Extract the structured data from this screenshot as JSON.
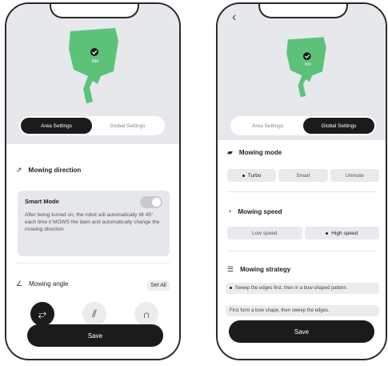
{
  "left_screen": {
    "tabs": [
      {
        "label": "Area Settings",
        "active": true
      },
      {
        "label": "Global Settings",
        "active": false
      }
    ],
    "mowing_direction_title": "Mowing direction",
    "smart_mode": {
      "title": "Smart Mode",
      "enabled": false,
      "description": "After being turned on, the robot will automatically tilt 45° each time it MOWS the lawn and automatically change the mowing direction"
    },
    "mowing_angle_title": "Mowing angle",
    "set_all_label": "Set All",
    "pattern_icons": [
      "bow-pattern-icon",
      "diagonal-pattern-icon",
      "vertical-pattern-icon"
    ],
    "save_label": "Save",
    "map_label": "899"
  },
  "right_screen": {
    "tabs": [
      {
        "label": "Area Settings",
        "active": false
      },
      {
        "label": "Global Settings",
        "active": true
      }
    ],
    "mowing_mode": {
      "title": "Mowing mode",
      "options": [
        {
          "label": "Turbo",
          "selected": true
        },
        {
          "label": "Smart",
          "selected": false
        },
        {
          "label": "Unmute",
          "selected": false
        }
      ]
    },
    "mowing_speed": {
      "title": "Mowing speed",
      "options": [
        {
          "label": "Low speed",
          "selected": false
        },
        {
          "label": "High speed",
          "selected": true
        }
      ]
    },
    "mowing_strategy": {
      "title": "Mowing strategy",
      "options": [
        {
          "label": "Sweep the edges first, then in a bow-shaped pattern.",
          "selected": true
        },
        {
          "label": "First form a bow shape, then sweep the edges.",
          "selected": false
        }
      ]
    },
    "save_label": "Save",
    "map_label": "899"
  },
  "colors": {
    "map_green": "#5cc27a",
    "dark": "#1b1b1b",
    "screen_bg": "#e6e8ec"
  }
}
